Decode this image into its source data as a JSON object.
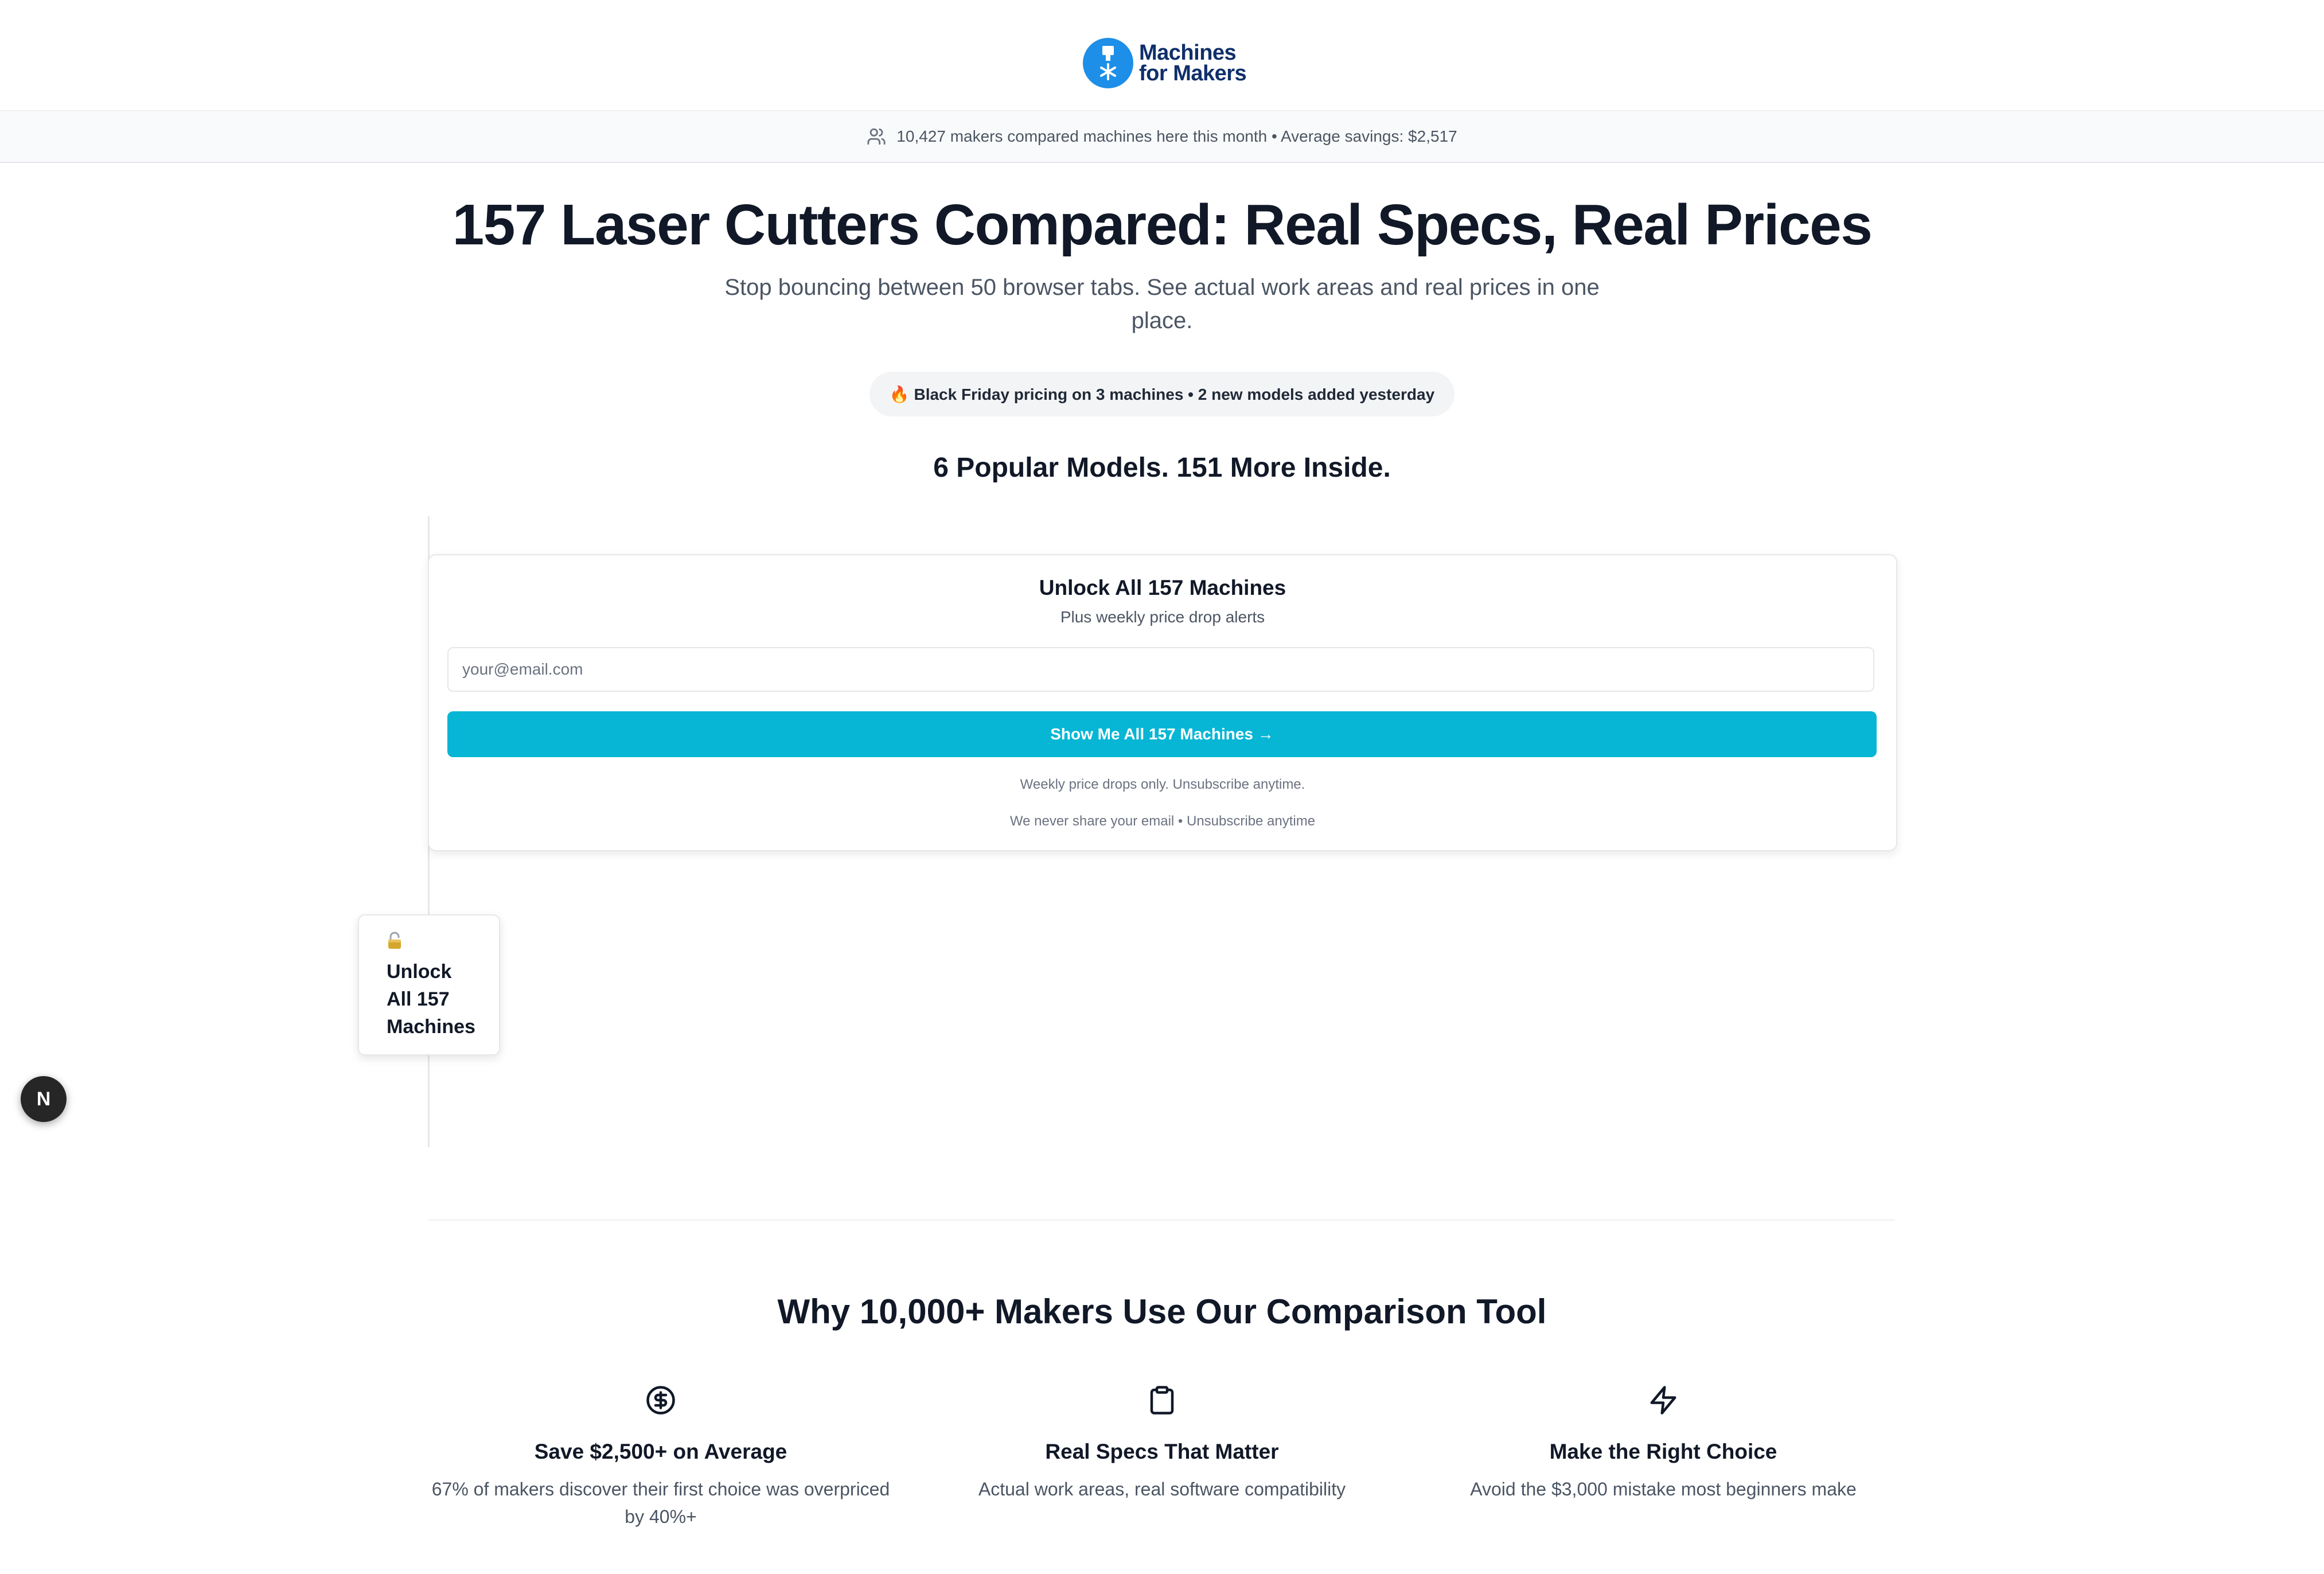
{
  "brand": {
    "name_line1": "Machines",
    "name_line2": "for Makers",
    "color": "#1d8fe8"
  },
  "social_proof": {
    "text": "10,427 makers compared machines here this month • Average savings: $2,517"
  },
  "hero": {
    "title": "157 Laser Cutters Compared: Real Specs, Real Prices",
    "subtitle": "Stop bouncing between 50 browser tabs. See actual work areas and real prices in one place.",
    "promo": "🔥 Black Friday pricing on 3 machines • 2 new models added yesterday"
  },
  "models_section": {
    "title": "6 Popular Models. 151 More Inside."
  },
  "unlock_card": {
    "title": "Unlock All 157 Machines",
    "subtitle": "Plus weekly price drop alerts",
    "email_placeholder": "your@email.com",
    "email_value": "",
    "cta_label": "Show Me All 157 Machines →",
    "fine_print_1": "Weekly price drops only. Unsubscribe anytime.",
    "fine_print_2": "We never share your email • Unsubscribe anytime",
    "accent_color": "#06b6d4"
  },
  "floating_unlock": {
    "icon": "lock-icon",
    "line1": "Unlock",
    "line2": "All 157",
    "line3": "Machines"
  },
  "dev_badge": {
    "label": "N"
  },
  "why": {
    "title": "Why 10,000+ Makers Use Our Comparison Tool",
    "features": [
      {
        "icon": "dollar-circle-icon",
        "title": "Save $2,500+ on Average",
        "description": "67% of makers discover their first choice was overpriced by 40%+"
      },
      {
        "icon": "clipboard-icon",
        "title": "Real Specs That Matter",
        "description": "Actual work areas, real software compatibility"
      },
      {
        "icon": "lightning-icon",
        "title": "Make the Right Choice",
        "description": "Avoid the $3,000 mistake most beginners make"
      }
    ]
  }
}
